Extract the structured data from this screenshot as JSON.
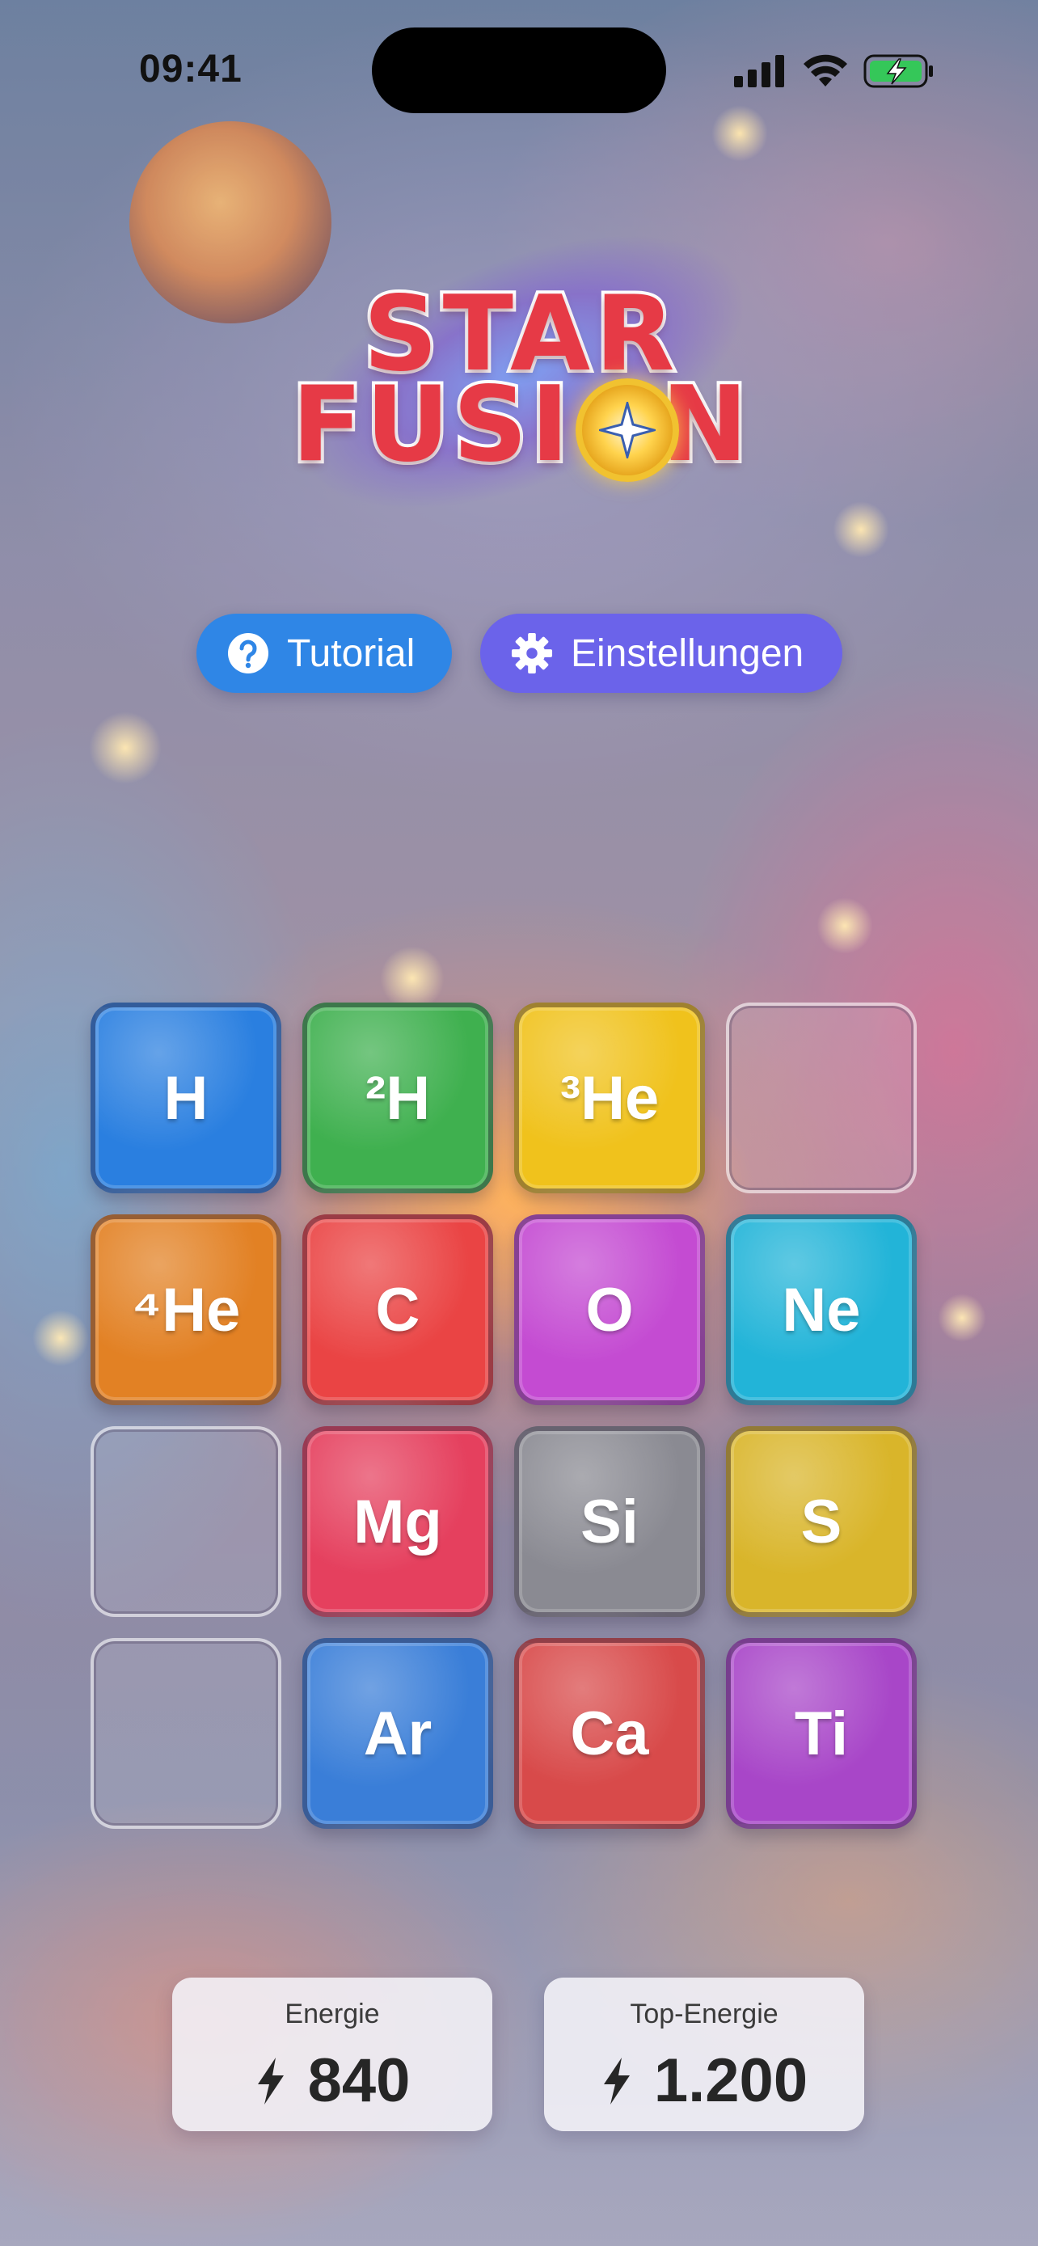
{
  "status_bar": {
    "time": "09:41",
    "icons": [
      "cellular-signal-icon",
      "wifi-icon",
      "battery-charging-icon"
    ]
  },
  "logo": {
    "line1": "STAR",
    "line2": "FUSI",
    "line2_end": "N"
  },
  "buttons": {
    "tutorial": {
      "label": "Tutorial",
      "icon": "question-circle-icon",
      "color": "#2f86e6"
    },
    "settings": {
      "label": "Einstellungen",
      "icon": "gear-icon",
      "color": "#6b63ea"
    }
  },
  "grid": {
    "rows": [
      [
        {
          "symbol": "H",
          "color": "#2a7fe0"
        },
        {
          "symbol": "²H",
          "color": "#3fb04f"
        },
        {
          "symbol": "³He",
          "color": "#f0c21c"
        },
        {
          "symbol": "",
          "empty": true
        }
      ],
      [
        {
          "symbol": "⁴He",
          "color": "#e28124"
        },
        {
          "symbol": "C",
          "color": "#ea4444"
        },
        {
          "symbol": "O",
          "color": "#c44bd2"
        },
        {
          "symbol": "Ne",
          "color": "#22b4d8"
        }
      ],
      [
        {
          "symbol": "",
          "empty": true
        },
        {
          "symbol": "Mg",
          "color": "#e5405e"
        },
        {
          "symbol": "Si",
          "color": "#8a8a92"
        },
        {
          "symbol": "S",
          "color": "#d9b52a"
        }
      ],
      [
        {
          "symbol": "",
          "empty": true
        },
        {
          "symbol": "Ar",
          "color": "#3a7ed8"
        },
        {
          "symbol": "Ca",
          "color": "#d84a4a"
        },
        {
          "symbol": "Ti",
          "color": "#a846c8"
        }
      ]
    ]
  },
  "scores": {
    "energy": {
      "label": "Energie",
      "value": "840",
      "icon": "lightning-icon"
    },
    "top_energy": {
      "label": "Top-Energie",
      "value": "1.200",
      "icon": "lightning-icon"
    }
  }
}
